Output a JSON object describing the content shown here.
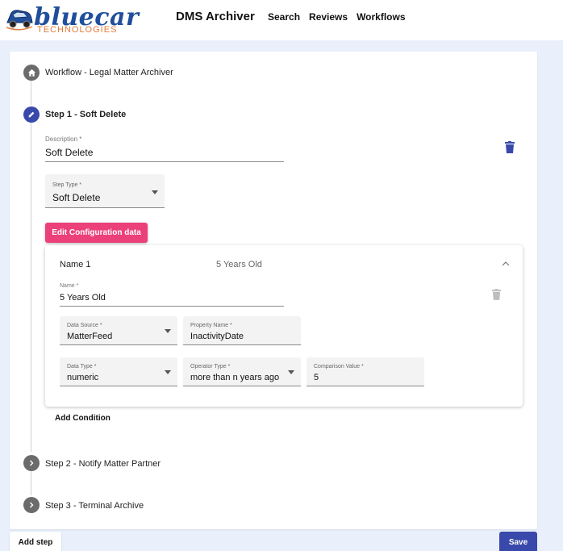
{
  "header": {
    "logo_word": "bluecar",
    "logo_sub": "TECHNOLOGIES",
    "app_title": "DMS Archiver",
    "nav": [
      {
        "label": "Search"
      },
      {
        "label": "Reviews"
      },
      {
        "label": "Workflows"
      }
    ]
  },
  "workflow": {
    "title": "Workflow - Legal Matter Archiver",
    "steps": [
      {
        "label": "Step 1 - Soft Delete",
        "state": "active"
      },
      {
        "label": "Step 2 - Notify Matter Partner",
        "state": "collapsed"
      },
      {
        "label": "Step 3 - Terminal Archive",
        "state": "collapsed"
      }
    ]
  },
  "step1": {
    "description_label": "Description *",
    "description_value": "Soft Delete",
    "step_type_label": "Step Type *",
    "step_type_value": "Soft Delete",
    "edit_config_label": "Edit Configuration data",
    "add_condition_label": "Add Condition"
  },
  "condition": {
    "header_name": "Name 1",
    "header_summary": "5 Years Old",
    "name_label": "Name *",
    "name_value": "5 Years Old",
    "data_source_label": "Data Source *",
    "data_source_value": "MatterFeed",
    "property_name_label": "Property Name *",
    "property_name_value": "InactivityDate",
    "data_type_label": "Data Type *",
    "data_type_value": "numeric",
    "operator_type_label": "Operator Type *",
    "operator_type_value": "more than n years ago",
    "comparison_label": "Comparison Value *",
    "comparison_value": "5"
  },
  "footer": {
    "add_step_label": "Add step",
    "save_label": "Save"
  },
  "colors": {
    "primary": "#3949ab",
    "accent": "#ec407a",
    "background": "#e9f0fb"
  }
}
